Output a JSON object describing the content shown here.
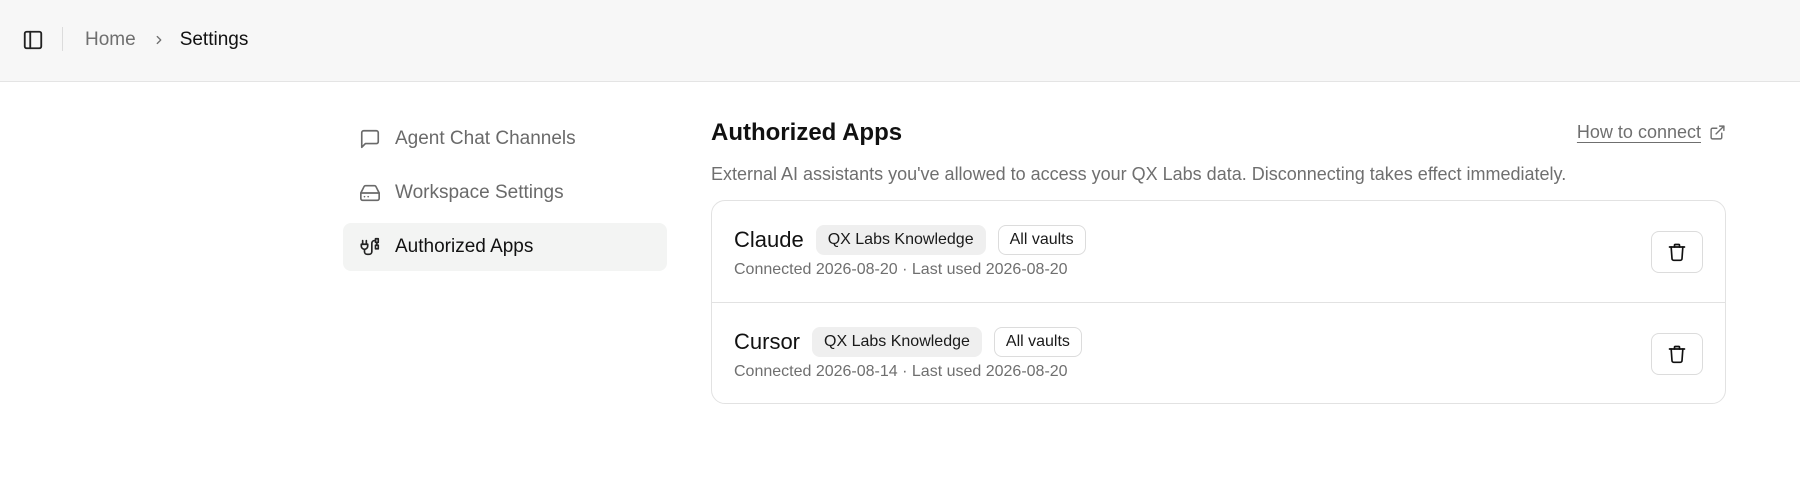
{
  "breadcrumb": {
    "home": "Home",
    "current": "Settings"
  },
  "nav": {
    "items": [
      {
        "label": "Agent Chat Channels",
        "icon": "message-square-icon",
        "active": false
      },
      {
        "label": "Workspace Settings",
        "icon": "hard-drive-icon",
        "active": false
      },
      {
        "label": "Authorized Apps",
        "icon": "plug-cable-icon",
        "active": true
      }
    ]
  },
  "main": {
    "title": "Authorized Apps",
    "how_to_connect": "How to connect",
    "description": "External AI assistants you've allowed to access your QX Labs data. Disconnecting takes effect immediately.",
    "apps": [
      {
        "name": "Claude",
        "badges": [
          "QX Labs Knowledge",
          "All vaults"
        ],
        "meta": "Connected 2026-08-20 · Last used 2026-08-20"
      },
      {
        "name": "Cursor",
        "badges": [
          "QX Labs Knowledge",
          "All vaults"
        ],
        "meta": "Connected 2026-08-14 · Last used 2026-08-20"
      }
    ]
  },
  "colors": {
    "topbar_bg": "#f7f7f7",
    "active_nav_bg": "#f3f4f3",
    "muted_text": "#6f6f6f",
    "border": "#e2e2e2"
  }
}
